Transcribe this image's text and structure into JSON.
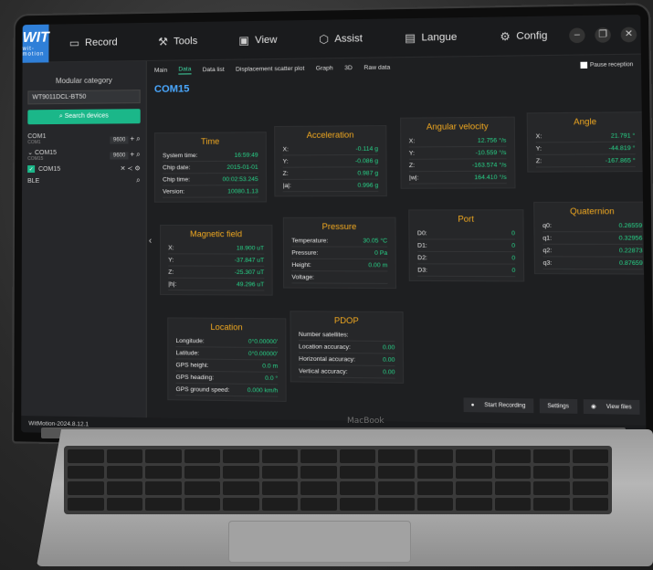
{
  "app": {
    "logo": "WIT",
    "logo_sub": "wit-motion",
    "version": "WitMotion-2024.8.12.1",
    "brand": "MacBook"
  },
  "menu": [
    {
      "label": "Record",
      "icon": "record-icon"
    },
    {
      "label": "Tools",
      "icon": "tools-icon"
    },
    {
      "label": "View",
      "icon": "view-icon"
    },
    {
      "label": "Assist",
      "icon": "assist-icon"
    },
    {
      "label": "Langue",
      "icon": "language-icon"
    },
    {
      "label": "Config",
      "icon": "gear-icon"
    }
  ],
  "sidebar": {
    "title": "Modular category",
    "model": "WT9011DCL-BT50",
    "search_label": "Search devices",
    "ports": [
      {
        "name": "COM1",
        "sub": "COM1",
        "baud": "9600"
      },
      {
        "name": "COM15",
        "sub": "COM15",
        "baud": "9600"
      }
    ],
    "device": "COM15",
    "ble": "BLE"
  },
  "tabs": [
    "Main",
    "Data",
    "Data list",
    "Displacement scatter plot",
    "Graph",
    "3D",
    "Raw data"
  ],
  "active_tab": "Data",
  "pause_label": "Pause reception",
  "com_title": "COM15",
  "time": {
    "title": "Time",
    "rows": [
      {
        "k": "System time:",
        "v": "16:59:49"
      },
      {
        "k": "Chip date:",
        "v": "2015-01-01"
      },
      {
        "k": "Chip time:",
        "v": "00:02:53.245"
      },
      {
        "k": "Version:",
        "v": "10080.1.13"
      }
    ]
  },
  "acceleration": {
    "title": "Acceleration",
    "rows": [
      {
        "k": "X:",
        "v": "-0.114 g"
      },
      {
        "k": "Y:",
        "v": "-0.086 g"
      },
      {
        "k": "Z:",
        "v": "0.987 g"
      },
      {
        "k": "|a|:",
        "v": "0.996 g"
      }
    ]
  },
  "angular": {
    "title": "Angular velocity",
    "rows": [
      {
        "k": "X:",
        "v": "12.756 °/s"
      },
      {
        "k": "Y:",
        "v": "-10.559 °/s"
      },
      {
        "k": "Z:",
        "v": "-163.574 °/s"
      },
      {
        "k": "|w|:",
        "v": "164.410 °/s"
      }
    ]
  },
  "angle": {
    "title": "Angle",
    "rows": [
      {
        "k": "X:",
        "v": "21.791 °"
      },
      {
        "k": "Y:",
        "v": "-44.819 °"
      },
      {
        "k": "Z:",
        "v": "-167.865 °"
      }
    ]
  },
  "magnetic": {
    "title": "Magnetic field",
    "rows": [
      {
        "k": "X:",
        "v": "18.900 uT"
      },
      {
        "k": "Y:",
        "v": "-37.847 uT"
      },
      {
        "k": "Z:",
        "v": "-25.307 uT"
      },
      {
        "k": "|h|:",
        "v": "49.296 uT"
      }
    ]
  },
  "pressure": {
    "title": "Pressure",
    "rows": [
      {
        "k": "Temperature:",
        "v": "30.05 °C"
      },
      {
        "k": "Pressure:",
        "v": "0 Pa"
      },
      {
        "k": "Height:",
        "v": "0.00 m"
      },
      {
        "k": "Voltage:",
        "v": ""
      }
    ]
  },
  "port": {
    "title": "Port",
    "rows": [
      {
        "k": "D0:",
        "v": "0"
      },
      {
        "k": "D1:",
        "v": "0"
      },
      {
        "k": "D2:",
        "v": "0"
      },
      {
        "k": "D3:",
        "v": "0"
      }
    ]
  },
  "quaternion": {
    "title": "Quaternion",
    "rows": [
      {
        "k": "q0:",
        "v": "0.26559"
      },
      {
        "k": "q1:",
        "v": "0.32956"
      },
      {
        "k": "q2:",
        "v": "0.22873"
      },
      {
        "k": "q3:",
        "v": "0.87659"
      }
    ]
  },
  "location": {
    "title": "Location",
    "rows": [
      {
        "k": "Longitude:",
        "v": "0°0.00000'"
      },
      {
        "k": "Latitude:",
        "v": "0°0.00000'"
      },
      {
        "k": "GPS height:",
        "v": "0.0 m"
      },
      {
        "k": "GPS heading:",
        "v": "0.0 °"
      },
      {
        "k": "GPS ground speed:",
        "v": "0.000 km/h"
      }
    ]
  },
  "pdop": {
    "title": "PDOP",
    "rows": [
      {
        "k": "Number satellites:",
        "v": ""
      },
      {
        "k": "Location accuracy:",
        "v": "0.00"
      },
      {
        "k": "Horizontal accuracy:",
        "v": "0.00"
      },
      {
        "k": "Vertical accuracy:",
        "v": "0.00"
      }
    ]
  },
  "footer": {
    "start_recording": "Start Recording",
    "settings": "Settings",
    "view_files": "View files"
  },
  "colors": {
    "accent": "#1bb789",
    "value": "#27d68a",
    "card_title": "#f0a820",
    "com_title": "#4aa8ff",
    "logo_bg": "#2f7fd8"
  }
}
